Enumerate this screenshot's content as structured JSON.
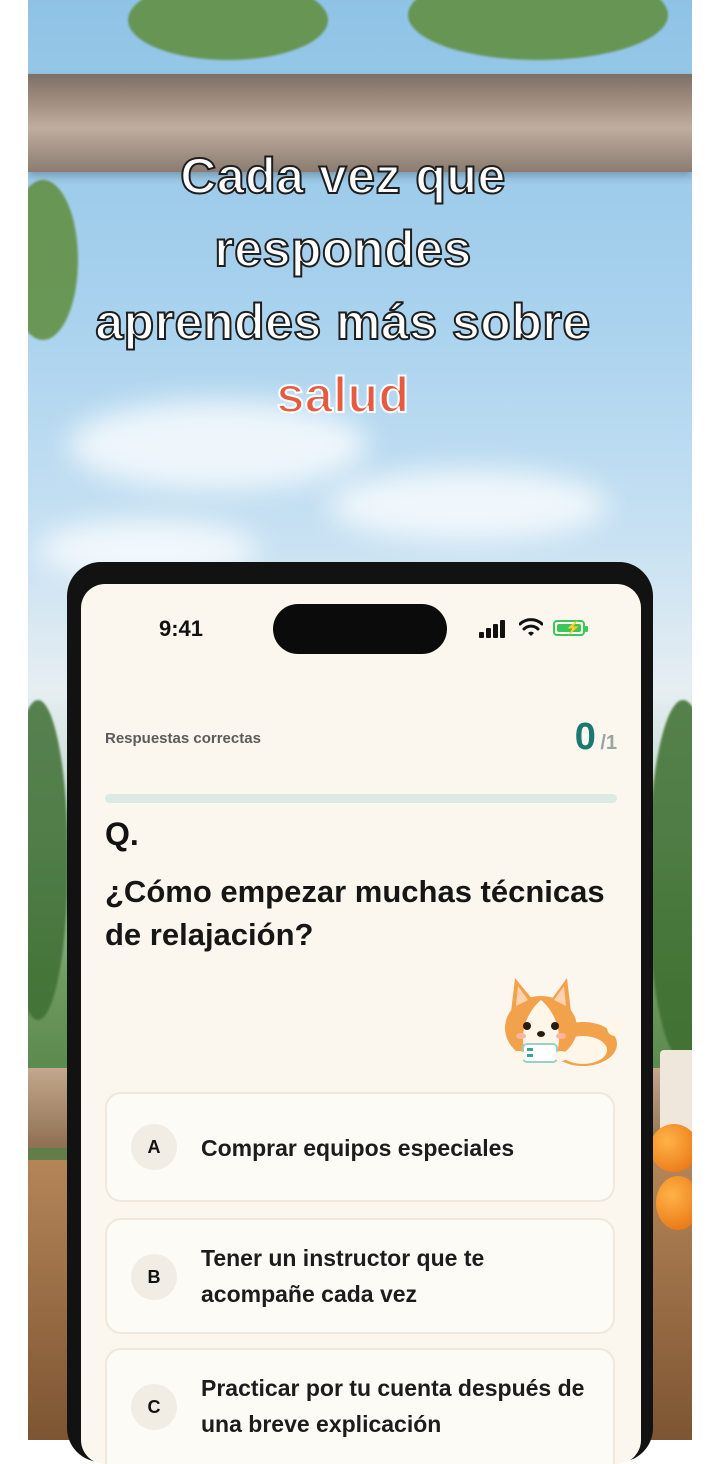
{
  "headline": {
    "line1": "Cada vez que",
    "line2": "respondes",
    "line3": "aprendes más sobre",
    "accent": "salud"
  },
  "status_bar": {
    "time": "9:41",
    "icons": [
      "signal-icon",
      "wifi-icon",
      "battery-charging-icon"
    ]
  },
  "quiz": {
    "score_label": "Respuestas correctas",
    "score_correct": "0",
    "score_total": "/1",
    "progress": 0,
    "q_marker": "Q.",
    "question": "¿Cómo empezar muchas técnicas de relajación?",
    "mascot": "corgi-mascot",
    "options": [
      {
        "letter": "A",
        "text": "Comprar equipos especiales"
      },
      {
        "letter": "B",
        "text": "Tener un instructor que te acompañe cada vez"
      },
      {
        "letter": "C",
        "text": "Practicar por tu cuenta después de una breve explicación"
      }
    ]
  },
  "colors": {
    "accent": "#e65a40",
    "teal": "#1a7a72",
    "screen_bg": "#fbf7ee"
  }
}
